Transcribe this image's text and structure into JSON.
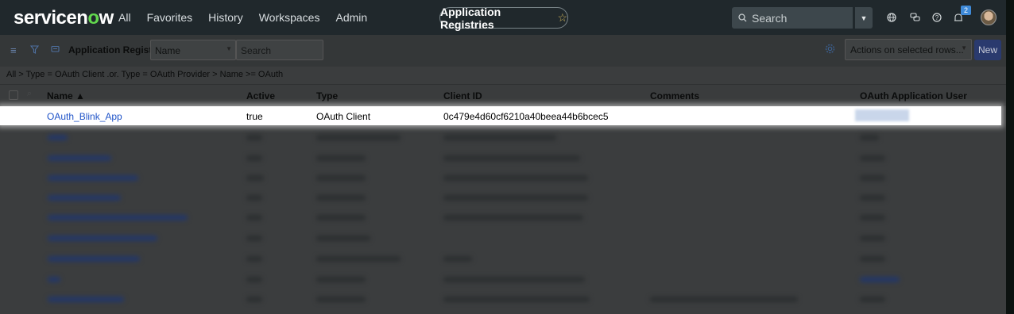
{
  "brand": {
    "name_pre": "servicen",
    "name_o": "o",
    "name_post": "w"
  },
  "nav": [
    "All",
    "Favorites",
    "History",
    "Workspaces",
    "Admin"
  ],
  "app_pill": {
    "label": "Application Registries",
    "star": "☆"
  },
  "global_search": {
    "placeholder": "Search",
    "icon": "search-icon"
  },
  "notifications": {
    "count": "2"
  },
  "list": {
    "title": "Application Registries",
    "field_select": "Name",
    "search_placeholder": "Search",
    "actions_label": "Actions on selected rows...",
    "new_label": "New",
    "breadcrumb": "All > Type = OAuth Client .or. Type = OAuth Provider > Name >= OAuth"
  },
  "columns": [
    "Name ▲",
    "Active",
    "Type",
    "Client ID",
    "Comments",
    "OAuth Application User"
  ],
  "highlight_row": {
    "name": "OAuth_Blink_App",
    "active": "true",
    "type": "OAuth Client",
    "client_id": "0c479e4d60cf6210a40beea44b6bcec5",
    "comments": ""
  },
  "colors": {
    "nav_bg": "#20282c",
    "link": "#1f53c8",
    "new_button": "#2a3a6e",
    "brand_green": "#62d84e"
  }
}
